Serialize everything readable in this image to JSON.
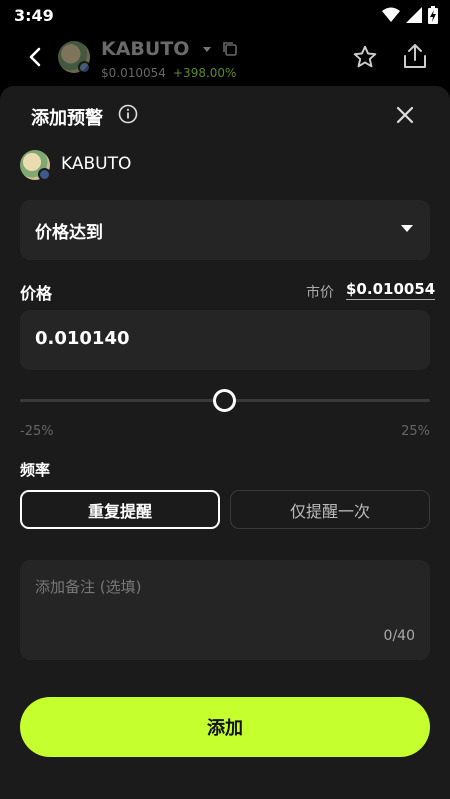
{
  "status_bar": {
    "time": "3:49"
  },
  "header": {
    "token_name": "KABUTO",
    "price": "$0.010054",
    "change": "+398.00%"
  },
  "sheet": {
    "title": "添加预警",
    "token_name": "KABUTO",
    "condition": {
      "selected": "价格达到"
    },
    "price_label": "价格",
    "market_label": "市价",
    "market_value": "$0.010054",
    "price_value": "0.010140",
    "slider": {
      "min_label": "-25%",
      "max_label": "25%",
      "value_percent": 0.86
    },
    "frequency_label": "频率",
    "frequency_options": [
      "重复提醒",
      "仅提醒一次"
    ],
    "frequency_selected": "重复提醒",
    "note": {
      "placeholder": "添加备注 (选填)",
      "counter": "0/40"
    },
    "add_button": "添加"
  },
  "colors": {
    "accent": "#c5ff2e",
    "sheet_bg": "#1b1b1b",
    "field_bg": "#252525",
    "positive": "#5b8a2c"
  }
}
